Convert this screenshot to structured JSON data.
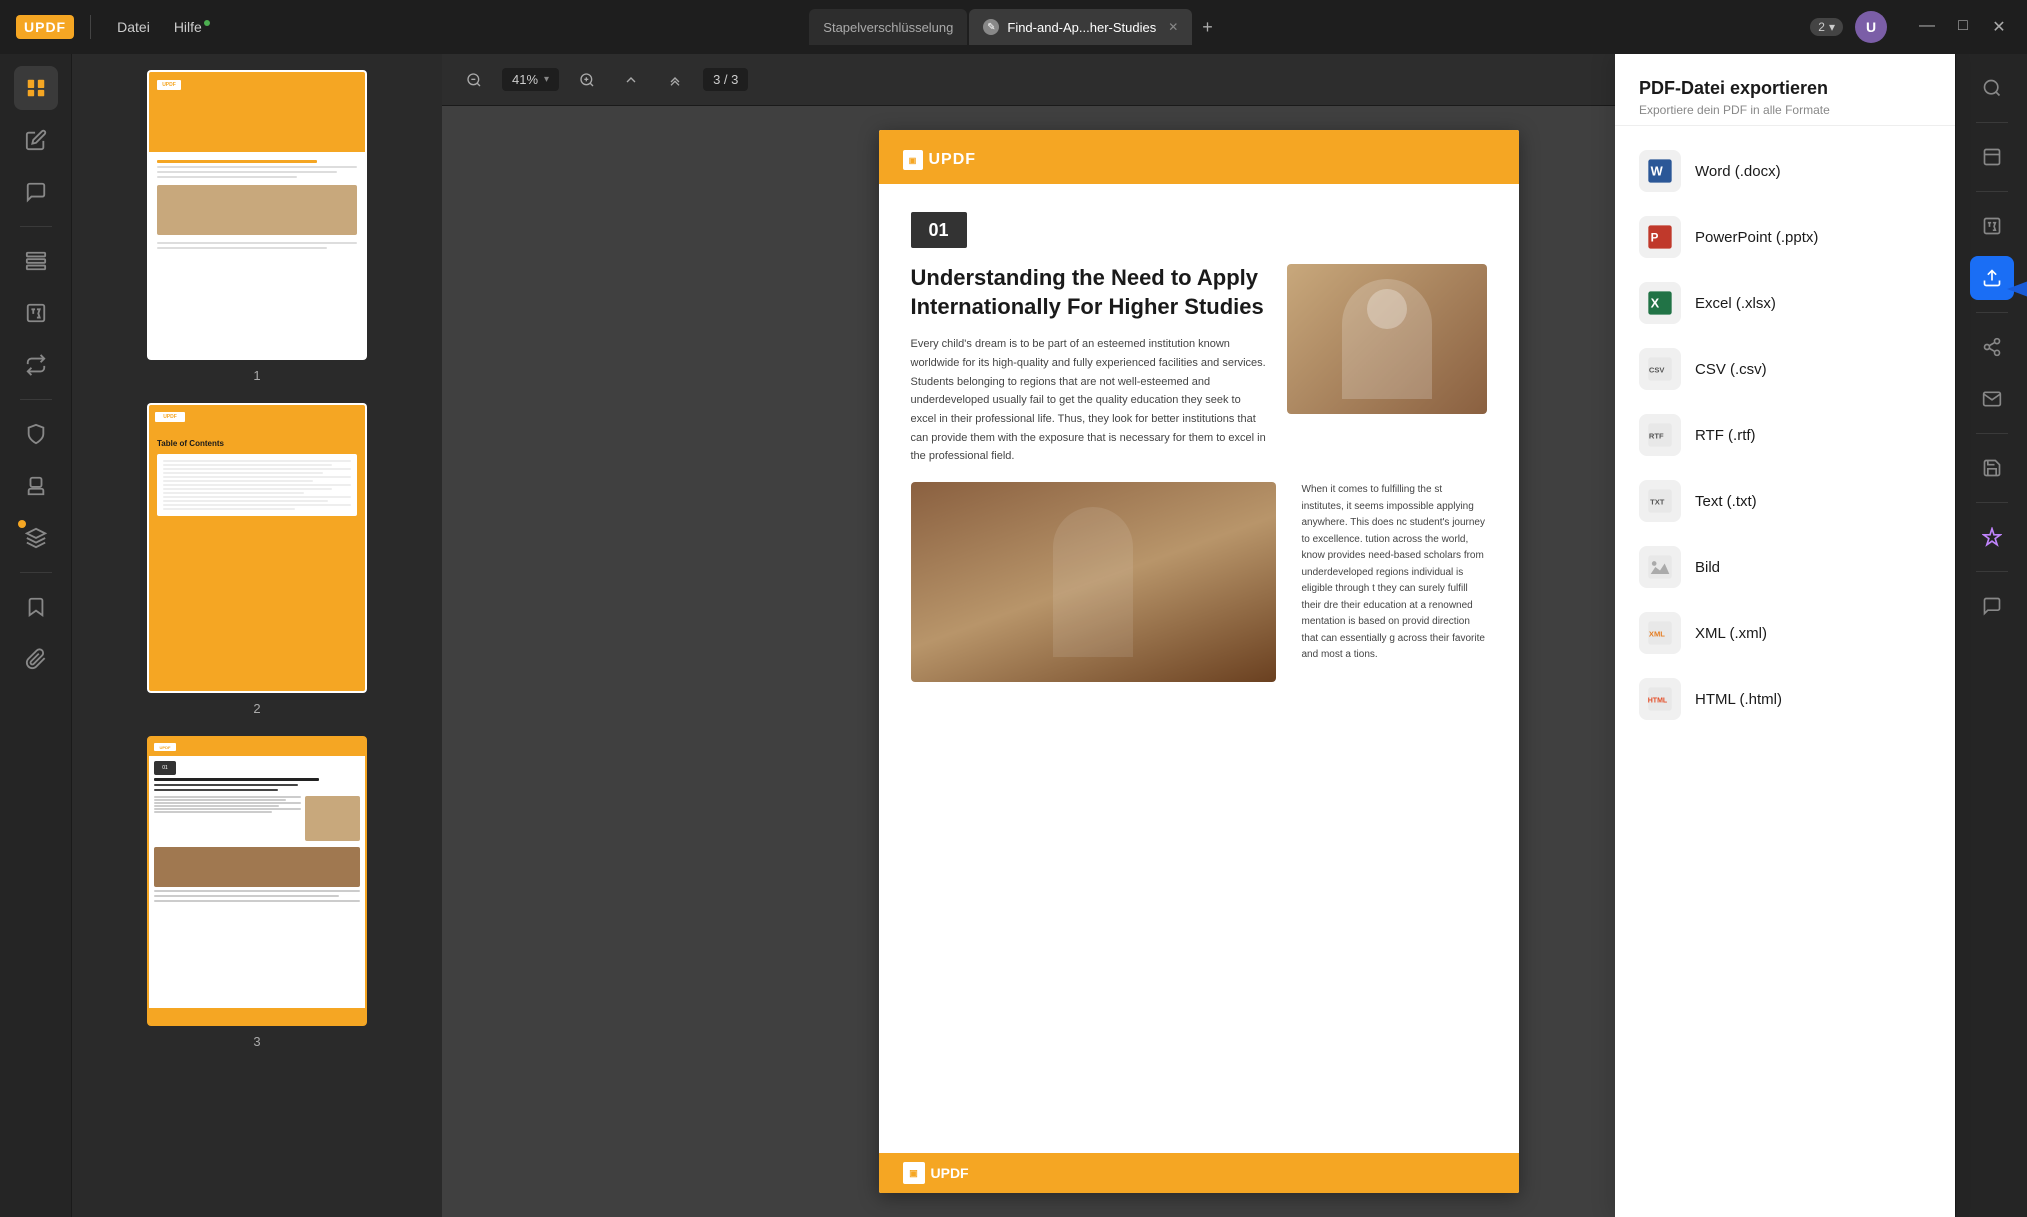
{
  "app": {
    "logo": "UPDF",
    "menus": [
      "Datei",
      "Hilfe"
    ],
    "hilfe_dot": true,
    "tabs": [
      {
        "id": "stapel",
        "label": "Stapelverschlüsselung",
        "active": false,
        "closeable": false
      },
      {
        "id": "find",
        "label": "Find-and-Ap...her-Studies",
        "active": true,
        "closeable": true
      }
    ],
    "add_tab": "+",
    "version": "2",
    "user_initial": "U",
    "window_controls": [
      "—",
      "□",
      "✕"
    ]
  },
  "left_toolbar": {
    "buttons": [
      {
        "id": "reader",
        "icon": "reader",
        "active": true
      },
      {
        "id": "edit",
        "icon": "edit"
      },
      {
        "id": "comment",
        "icon": "comment"
      },
      {
        "id": "organize",
        "icon": "organize"
      },
      {
        "id": "ocr",
        "icon": "ocr"
      },
      {
        "id": "convert",
        "icon": "convert"
      },
      {
        "id": "protect",
        "icon": "protect"
      },
      {
        "id": "stamp",
        "icon": "stamp"
      },
      {
        "id": "layers",
        "icon": "layers"
      },
      {
        "id": "bookmark",
        "icon": "bookmark"
      },
      {
        "id": "attachment",
        "icon": "attachment"
      }
    ]
  },
  "pdf_toolbar": {
    "zoom_out": "−",
    "zoom_value": "41%",
    "zoom_in": "+",
    "page_up_single": "↑",
    "page_up_double": "↑↑",
    "page_display": "3 / 3",
    "page_input_placeholder": "3"
  },
  "thumbnails": [
    {
      "number": "1"
    },
    {
      "number": "2",
      "selected": false
    },
    {
      "number": "3",
      "selected": true
    }
  ],
  "pdf_page": {
    "header_logo": "UPDF",
    "article_number": "01",
    "article_title": "Understanding the Need to Apply Internationally For Higher Studies",
    "article_body": "Every child's dream is to be part of an esteemed institution known worldwide for its high-quality and fully experienced facilities and services. Students belonging to regions that are not well-esteemed and underdeveloped usually fail to get the quality education they seek to excel in their professional life. Thus, they look for better institutions that can provide them with the exposure that is necessary for them to excel in the professional field.",
    "right_col_text": "When it comes to fulfilling the st institutes, it seems impossible applying anywhere. This does nc student's journey to excellence. tution across the world, know provides need-based scholars from underdeveloped regions individual is eligible through t they can surely fulfill their dre their education at a renowned mentation is based on provid direction that can essentially g across their favorite and most a tions.",
    "footer_logo": "UPDF"
  },
  "export_panel": {
    "title": "PDF-Datei exportieren",
    "subtitle": "Exportiere dein PDF in alle Formate",
    "items": [
      {
        "id": "word",
        "label": "Word (.docx)",
        "icon_type": "word"
      },
      {
        "id": "ppt",
        "label": "PowerPoint (.pptx)",
        "icon_type": "ppt"
      },
      {
        "id": "excel",
        "label": "Excel (.xlsx)",
        "icon_type": "excel"
      },
      {
        "id": "csv",
        "label": "CSV (.csv)",
        "icon_type": "csv"
      },
      {
        "id": "rtf",
        "label": "RTF (.rtf)",
        "icon_type": "rtf"
      },
      {
        "id": "txt",
        "label": "Text (.txt)",
        "icon_type": "txt"
      },
      {
        "id": "image",
        "label": "Bild",
        "icon_type": "image"
      },
      {
        "id": "xml",
        "label": "XML (.xml)",
        "icon_type": "xml"
      },
      {
        "id": "html",
        "label": "HTML (.html)",
        "icon_type": "html"
      }
    ]
  },
  "right_toolbar": {
    "buttons": [
      {
        "id": "search",
        "icon": "search"
      },
      {
        "id": "scroll-up",
        "icon": "scroll-up"
      },
      {
        "id": "ocr-right",
        "icon": "ocr-right"
      },
      {
        "id": "export-active",
        "icon": "export",
        "active_blue": true
      },
      {
        "id": "share",
        "icon": "share"
      },
      {
        "id": "email",
        "icon": "email"
      },
      {
        "id": "save",
        "icon": "save"
      },
      {
        "id": "magic",
        "icon": "magic"
      },
      {
        "id": "chat",
        "icon": "chat"
      }
    ]
  }
}
